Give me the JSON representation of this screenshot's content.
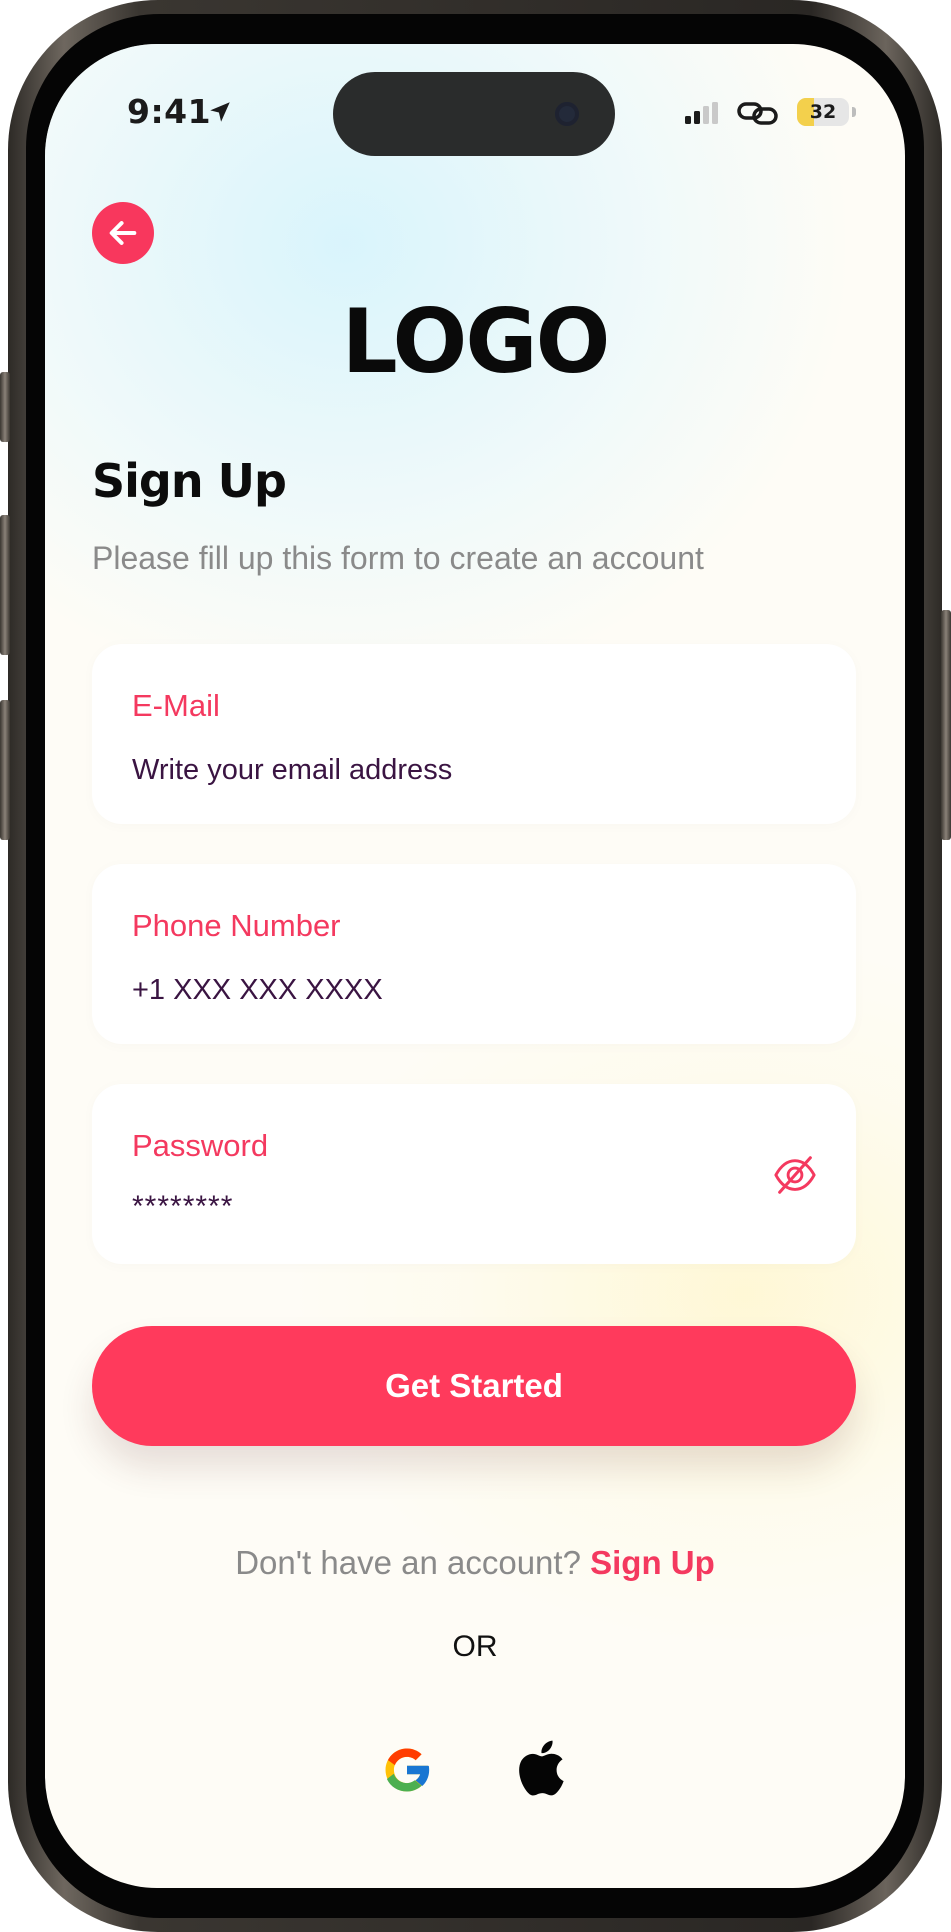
{
  "status_bar": {
    "time": "9:41",
    "battery": "32",
    "battery_level": 0.32
  },
  "header": {
    "logo": "LOGO"
  },
  "form": {
    "title": "Sign Up",
    "subtitle": "Please fill up this form to create an account",
    "email": {
      "label": "E-Mail",
      "placeholder": "Write your email address"
    },
    "phone": {
      "label": "Phone Number",
      "placeholder": "+1 XXX XXX XXXX"
    },
    "password": {
      "label": "Password",
      "value": "********"
    },
    "submit_label": "Get Started"
  },
  "footer": {
    "prompt": "Don't have an account?",
    "link_label": "Sign Up",
    "divider": "OR",
    "social": [
      "google-icon",
      "apple-icon"
    ]
  },
  "colors": {
    "accent": "#f8375d",
    "value_text": "#3a1442",
    "muted_text": "#8a8a8a"
  }
}
